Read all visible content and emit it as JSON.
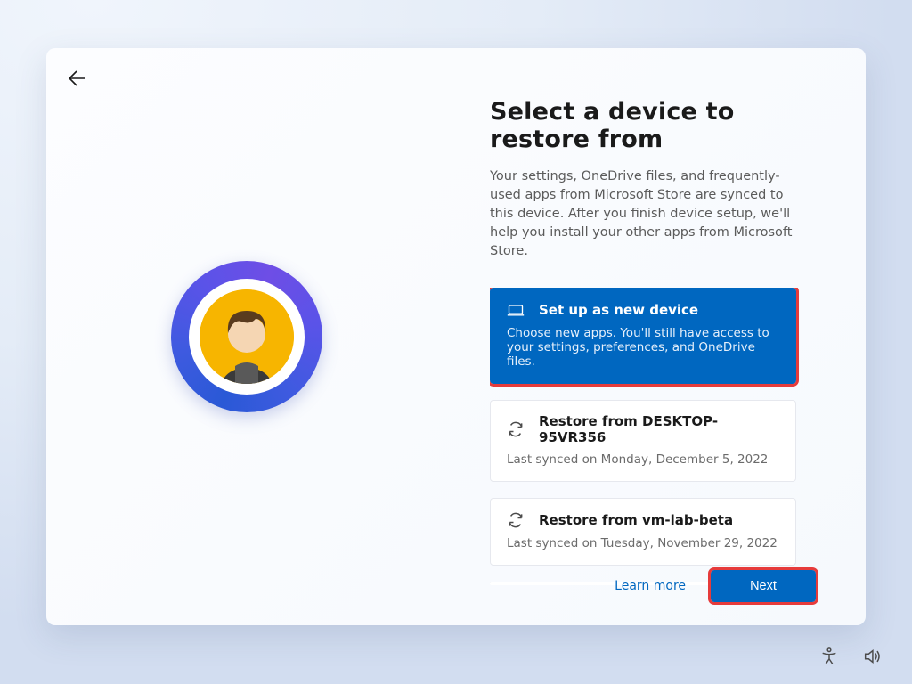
{
  "header": {
    "title": "Select a device to restore from",
    "subtitle": "Your settings, OneDrive files, and frequently-used apps from Microsoft Store are synced to this device. After you finish device setup, we'll help you install your other apps from Microsoft Store."
  },
  "options": [
    {
      "title": "Set up as new device",
      "subtitle": "Choose new apps. You'll still have access to your settings, preferences, and OneDrive files.",
      "selected": true
    },
    {
      "title": "Restore from DESKTOP-95VR356",
      "subtitle": "Last synced on Monday, December 5, 2022",
      "selected": false
    },
    {
      "title": "Restore from vm-lab-beta",
      "subtitle": "Last synced on Tuesday, November 29, 2022",
      "selected": false
    }
  ],
  "footer": {
    "learn_more": "Learn more",
    "next": "Next"
  }
}
